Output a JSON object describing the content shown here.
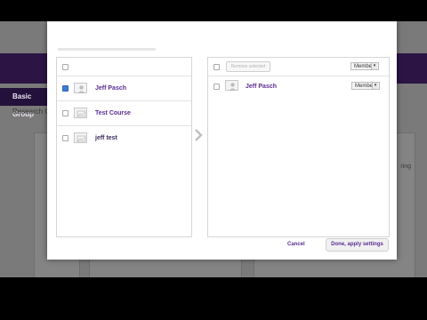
{
  "background": {
    "tab_label": "Basic Group",
    "sub_label": "Research Gr",
    "note": "ring"
  },
  "left_panel": {
    "items": [
      {
        "label": "Jeff Pasch",
        "checked": true,
        "icon": "user-avatar-icon"
      },
      {
        "label": "Test Course",
        "checked": false,
        "icon": "course-image-icon"
      },
      {
        "label": "jeff test",
        "checked": false,
        "icon": "course-image-icon"
      }
    ]
  },
  "right_panel": {
    "remove_selected_label": "Remove selected",
    "header_role": "Member",
    "items": [
      {
        "label": "Jeff Pasch",
        "role": "Member",
        "icon": "user-avatar-icon"
      }
    ]
  },
  "footer": {
    "cancel_label": "Cancel",
    "done_label": "Done, apply settings"
  },
  "colors": {
    "accent": "#5c2d91",
    "header": "#2c1545",
    "checkbox_checked": "#3b7bd6"
  }
}
